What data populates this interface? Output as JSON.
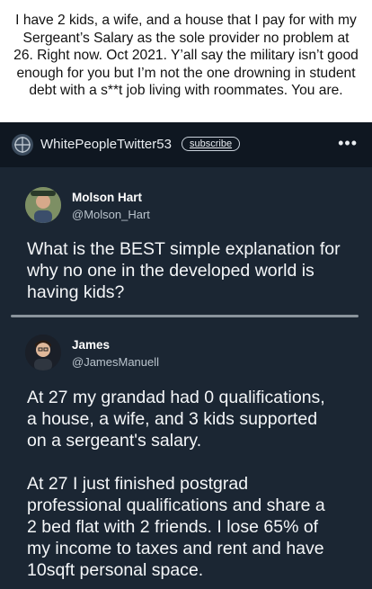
{
  "caption": {
    "text": "I have 2 kids, a wife, and a house that I pay for with my Sergeant’s Salary as the sole provider no problem at 26. Right now. Oct 2021. Y’all say the military isn’t good enough for you but I’m not the one drowning in student debt with a s**t job living with roommates. You are."
  },
  "header": {
    "subreddit": "WhitePeopleTwitter53",
    "subscribe_label": "subscribe",
    "more_label": "•••"
  },
  "tweet1": {
    "name": "Molson Hart",
    "handle": "@Molson_Hart",
    "text": "What is the BEST simple explanation for\nwhy no one in the developed world is\nhaving kids?"
  },
  "tweet2": {
    "name": "James",
    "handle": "@JamesManuell",
    "text": "At 27 my grandad had 0 qualifications,\na house, a wife, and 3 kids supported\non a sergeant's salary.\n\nAt 27 I just finished postgrad\nprofessional qualifications and share a\n2 bed flat with 2 friends. I lose 65% of\nmy income to taxes and rent and have\n10sqft personal space."
  },
  "colors": {
    "background": "#1b2633",
    "header_bar": "#0f1721",
    "text": "#f4f6f8",
    "handle": "#b9c3cc"
  }
}
